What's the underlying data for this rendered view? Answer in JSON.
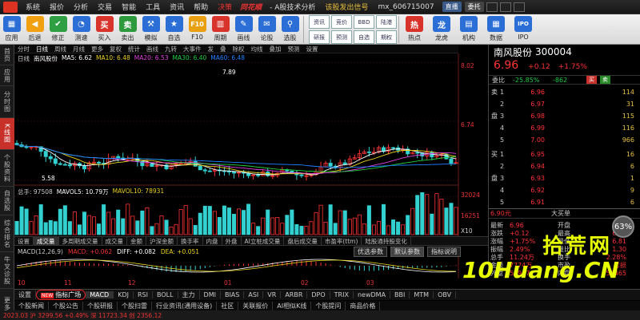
{
  "menubar": {
    "items": [
      "系统",
      "报价",
      "分析",
      "交易",
      "智能",
      "工具",
      "资讯",
      "帮助"
    ],
    "decision": "决策",
    "brand": "同花顺",
    "subtitle": "- A股技术分析",
    "alert": "该股发出信号",
    "account": "mx_606715007",
    "live": "直播",
    "sms": "委托"
  },
  "toolbar": {
    "items": [
      {
        "label": "应用",
        "icon": "grid",
        "color": "#2b6fd6"
      },
      {
        "label": "后退",
        "icon": "arrow-left",
        "color": "#f0a010"
      },
      {
        "label": "修正",
        "icon": "check",
        "color": "#2ea043"
      },
      {
        "label": "测速",
        "icon": "gauge",
        "color": "#2b6fd6"
      },
      {
        "label": "买入",
        "icon": "buy",
        "color": "#d8342b"
      },
      {
        "label": "卖出",
        "icon": "sell",
        "color": "#2e9a3e"
      },
      {
        "label": "模拟",
        "icon": "hammer",
        "color": "#2b6fd6"
      },
      {
        "label": "自选",
        "icon": "star",
        "color": "#2b6fd6"
      },
      {
        "label": "F10",
        "icon": "f10",
        "color": "#e8a010"
      },
      {
        "label": "周期",
        "icon": "chart",
        "color": "#d8342b"
      },
      {
        "label": "画线",
        "icon": "pen",
        "color": "#2b6fd6"
      },
      {
        "label": "论股",
        "icon": "chat",
        "color": "#2b6fd6"
      },
      {
        "label": "选股",
        "icon": "filter",
        "color": "#2b6fd6"
      }
    ],
    "mini": [
      "资讯",
      "竞价",
      "BBD",
      "陆港",
      "研报",
      "预测",
      "自选",
      "期权"
    ],
    "right": [
      {
        "label": "热点",
        "icon": "hot",
        "color": "#d8342b"
      },
      {
        "label": "龙虎",
        "icon": "dragon",
        "color": "#2b6fd6"
      },
      {
        "label": "机构",
        "icon": "org",
        "color": "#2b6fd6"
      },
      {
        "label": "数据",
        "icon": "data",
        "color": "#2b6fd6"
      },
      {
        "label": "IPO",
        "icon": "ipo",
        "color": "#2b6fd6"
      }
    ]
  },
  "lefttabs": [
    "首页",
    "应用",
    "分时图",
    "K线图",
    "个股资料",
    "自选股",
    "综合排名",
    "牛叉诊股",
    "更多"
  ],
  "chart": {
    "period_tabs": [
      "分时",
      "日线",
      "周线",
      "月线",
      "更多",
      "复权",
      "统计",
      "画线",
      "九转",
      "大事件",
      "发",
      "叠",
      "除权",
      "均线",
      "叠加",
      "预测",
      "设置"
    ],
    "ma_legend": {
      "title": "日线",
      "stock": "南风股份",
      "ma5": "MA5: 6.62",
      "ma10": "MA10: 6.48",
      "ma20": "MA20: 6.53",
      "ma30": "MA30: 6.40",
      "ma60": "MA60: 6.48"
    },
    "price_high_label": "7.89",
    "price_low_label": "5.58",
    "axis": {
      "top": "8.02",
      "mid": "6.74"
    },
    "vol_legend": {
      "total": "总手: 97508",
      "mavol5": "MAVOL5: 10.79万",
      "mavol10": "MAVOL10: 78931"
    },
    "vol_axis": {
      "top": "32024",
      "mid": "16251",
      "unit": "X10"
    },
    "colors": {
      "up": "#ff3333",
      "down": "#33d0d0",
      "ma5": "#ffffff",
      "ma10": "#e8d020",
      "ma20": "#e040e0",
      "ma30": "#20d040",
      "ma60": "#2080ff"
    }
  },
  "indicator_tabs": [
    "设置",
    "成交量",
    "多周期成交量",
    "成交量",
    "金额",
    "沪深金额",
    "换手率",
    "内盘",
    "外盘",
    "AI立桩成交量",
    "盘后成交量",
    "市盈率(ttm)",
    "陆股通持股变化"
  ],
  "macd": {
    "title": "MACD(12,26,9)",
    "macd": "MACD: +0.062",
    "diff": "DIFF: +0.082",
    "dea": "DEA: +0.051",
    "buttons": [
      "优选参数",
      "默认参数",
      "指标说明"
    ]
  },
  "dates": [
    "10",
    "11",
    "12",
    "01",
    "02",
    "03"
  ],
  "bottom_tabs": [
    "设置",
    "指标广场",
    "MACD",
    "KDJ",
    "RSI",
    "BOLL",
    "主力",
    "DMI",
    "BIAS",
    "ASI",
    "VR",
    "ARBR",
    "DPO",
    "TRIX",
    "newDMA",
    "BBI",
    "MTM",
    "OBV"
  ],
  "bottom_new": "NEW",
  "news_tabs": [
    "个股新闻",
    "个股公告",
    "个股研报",
    "个股扫雷",
    "行业资讯(通用设备)",
    "社区",
    "关联报价",
    "AI相似K线",
    "个股提问",
    "商品价格"
  ],
  "quote": {
    "name": "南风股份",
    "code": "300004",
    "price": "6.96",
    "change": "+0.12",
    "pct": "+1.75%",
    "ratio_label": "委比",
    "ratio_pct": "-25.85%",
    "ratio_diff": "-862",
    "buy_btn": "买",
    "sell_btn": "卖",
    "asks": [
      {
        "lvl": "5",
        "price": "7.00",
        "qty": "966"
      },
      {
        "lvl": "4",
        "price": "6.99",
        "qty": "116"
      },
      {
        "lvl": "3",
        "price": "6.98",
        "qty": "115"
      },
      {
        "lvl": "2",
        "price": "6.97",
        "qty": "31"
      },
      {
        "lvl": "1",
        "price": "6.96",
        "qty": "114"
      }
    ],
    "bids": [
      {
        "lvl": "1",
        "price": "6.95",
        "qty": "16"
      },
      {
        "lvl": "2",
        "price": "6.94",
        "qty": "6"
      },
      {
        "lvl": "3",
        "price": "6.93",
        "qty": "1"
      },
      {
        "lvl": "4",
        "price": "6.92",
        "qty": "9"
      },
      {
        "lvl": "5",
        "price": "6.91",
        "qty": "6"
      }
    ],
    "ask_side": "卖盘",
    "bid_side": "买盘",
    "last_trade": "6.90元",
    "big_order": "大买单",
    "stats": [
      {
        "k1": "最新",
        "v1": "6.96",
        "k2": "开盘",
        "v2": "6.86"
      },
      {
        "k1": "涨跌",
        "v1": "+0.12",
        "k2": "最高",
        "v2": "6.98"
      },
      {
        "k1": "涨幅",
        "v1": "+1.75%",
        "k2": "最低",
        "v2": "6.81"
      },
      {
        "k1": "振幅",
        "v1": "2.49%",
        "k2": "量比",
        "v2": "1.30"
      },
      {
        "k1": "总手",
        "v1": "11.24万",
        "k2": "换手",
        "v2": "2.28%"
      },
      {
        "k1": "金额",
        "v1": "7774万",
        "k2": "市盈",
        "v2": "亏损"
      },
      {
        "k1": "外盘",
        "v1": "54947",
        "k2": "内盘",
        "v2": "57465"
      }
    ]
  },
  "watermark": {
    "cn": "拾荒网",
    "en": "10Huang.CN",
    "badge": "63%"
  },
  "status": "2023.03  沪 3299.56  +0.49%  深 11723.34  创 2356.12"
}
